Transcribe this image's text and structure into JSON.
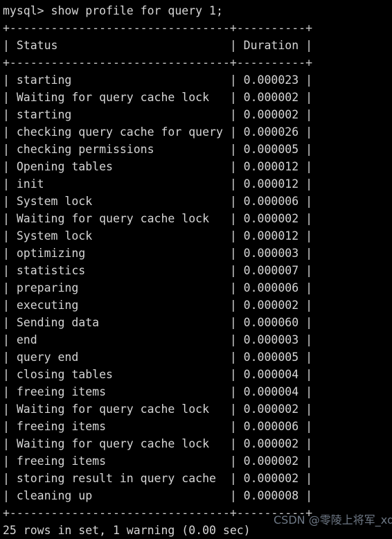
{
  "terminal": {
    "prompt_line": "mysql> show profile for query 1;",
    "separator": "+--------------------------------+----------+",
    "header_row": "| Status                         | Duration |",
    "footer": "25 rows in set, 1 warning (0.00 sec)",
    "watermark": "CSDN @零陵上将军_xdr",
    "colors": {
      "background": "#000000",
      "text": "#d6d6d6",
      "watermark": "#8d9aab"
    }
  },
  "table": {
    "columns": [
      "Status",
      "Duration"
    ],
    "row_count": 25,
    "rows": [
      {
        "status": "starting",
        "duration": "0.000023"
      },
      {
        "status": "Waiting for query cache lock",
        "duration": "0.000002"
      },
      {
        "status": "starting",
        "duration": "0.000002"
      },
      {
        "status": "checking query cache for query",
        "duration": "0.000026"
      },
      {
        "status": "checking permissions",
        "duration": "0.000005"
      },
      {
        "status": "Opening tables",
        "duration": "0.000012"
      },
      {
        "status": "init",
        "duration": "0.000012"
      },
      {
        "status": "System lock",
        "duration": "0.000006"
      },
      {
        "status": "Waiting for query cache lock",
        "duration": "0.000002"
      },
      {
        "status": "System lock",
        "duration": "0.000012"
      },
      {
        "status": "optimizing",
        "duration": "0.000003"
      },
      {
        "status": "statistics",
        "duration": "0.000007"
      },
      {
        "status": "preparing",
        "duration": "0.000006"
      },
      {
        "status": "executing",
        "duration": "0.000002"
      },
      {
        "status": "Sending data",
        "duration": "0.000060"
      },
      {
        "status": "end",
        "duration": "0.000003"
      },
      {
        "status": "query end",
        "duration": "0.000005"
      },
      {
        "status": "closing tables",
        "duration": "0.000004"
      },
      {
        "status": "freeing items",
        "duration": "0.000004"
      },
      {
        "status": "Waiting for query cache lock",
        "duration": "0.000002"
      },
      {
        "status": "freeing items",
        "duration": "0.000006"
      },
      {
        "status": "Waiting for query cache lock",
        "duration": "0.000002"
      },
      {
        "status": "freeing items",
        "duration": "0.000002"
      },
      {
        "status": "storing result in query cache",
        "duration": "0.000002"
      },
      {
        "status": "cleaning up",
        "duration": "0.000008"
      }
    ]
  }
}
